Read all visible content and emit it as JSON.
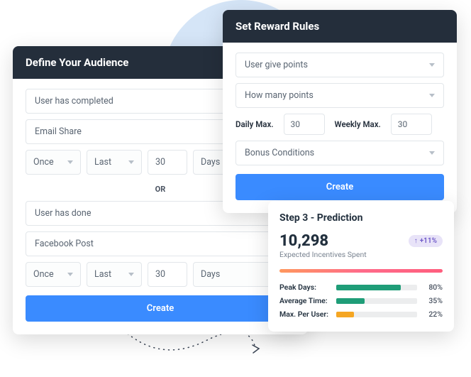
{
  "define": {
    "title": "Define Your Audience",
    "cond1": {
      "trigger": "User has completed",
      "channel": "Email Share",
      "freq": "Once",
      "range": "Last",
      "count": "30",
      "unit": "Days"
    },
    "or": "OR",
    "cond2": {
      "trigger": "User has done",
      "channel": "Facebook Post",
      "freq": "Once",
      "range": "Last",
      "count": "30",
      "unit": "Days"
    },
    "create": "Create"
  },
  "reward": {
    "title": "Set Reward Rules",
    "action": "User give points",
    "amount": "How many points",
    "daily_label": "Daily Max.",
    "daily_val": "30",
    "weekly_label": "Weekly Max.",
    "weekly_val": "30",
    "bonus": "Bonus Conditions",
    "create": "Create"
  },
  "prediction": {
    "title": "Step 3 - Prediction",
    "value": "10,298",
    "subtitle": "Expected Incentives Spent",
    "delta": "+11%",
    "peak": {
      "label": "Peak Days:",
      "pct": 80,
      "text": "80%",
      "color": "#1f9d78"
    },
    "avg": {
      "label": "Average Time:",
      "pct": 35,
      "text": "35%",
      "color": "#1f9d78"
    },
    "max": {
      "label": "Max. Per User:",
      "pct": 22,
      "text": "22%",
      "color": "#f5a623"
    }
  }
}
